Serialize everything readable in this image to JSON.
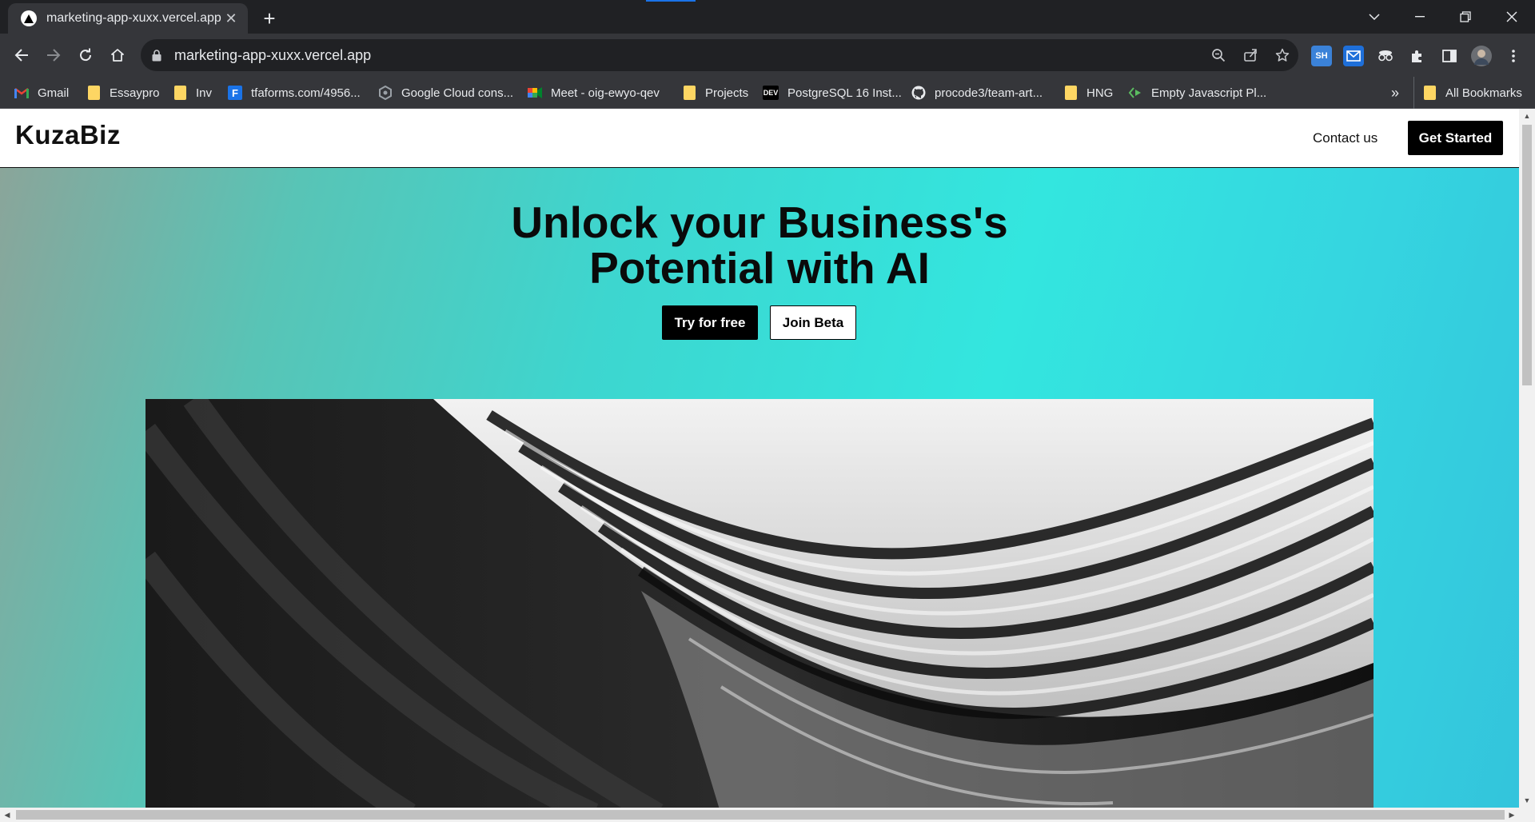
{
  "browser": {
    "tab": {
      "title": "marketing-app-xuxx.vercel.app",
      "close": "✕"
    },
    "new_tab": "+",
    "address": {
      "url": "marketing-app-xuxx.vercel.app"
    },
    "extensions": {
      "sh_label": "SH"
    },
    "bookmarks": [
      {
        "label": "Gmail",
        "icon": "gmail-icon"
      },
      {
        "label": "Essaypro",
        "icon": "folder-icon"
      },
      {
        "label": "Inv",
        "icon": "folder-icon"
      },
      {
        "label": "tfaforms.com/4956...",
        "icon": "formassembly-icon"
      },
      {
        "label": "Google Cloud cons...",
        "icon": "google-cloud-icon"
      },
      {
        "label": "Meet - oig-ewyo-qev",
        "icon": "meet-icon"
      },
      {
        "label": "Projects",
        "icon": "folder-icon"
      },
      {
        "label": "PostgreSQL 16 Inst...",
        "icon": "dev-icon"
      },
      {
        "label": "procode3/team-art...",
        "icon": "github-icon"
      },
      {
        "label": "HNG",
        "icon": "folder-icon"
      },
      {
        "label": "Empty Javascript Pl...",
        "icon": "playcode-icon"
      }
    ],
    "overflow": "»",
    "all_bookmarks": "All Bookmarks",
    "dev_badge": "DEV"
  },
  "site": {
    "logo": "KuzaBiz",
    "nav": {
      "contact": "Contact us",
      "get_started": "Get Started"
    },
    "hero": {
      "title_line1": "Unlock your Business's",
      "title_line2": "Potential with AI",
      "try_button": "Try for free",
      "beta_button": "Join Beta"
    }
  },
  "colors": {
    "accent_button": "#000000",
    "hero_gradient_start": "#8aa59a",
    "hero_gradient_end": "#33c4dc"
  }
}
